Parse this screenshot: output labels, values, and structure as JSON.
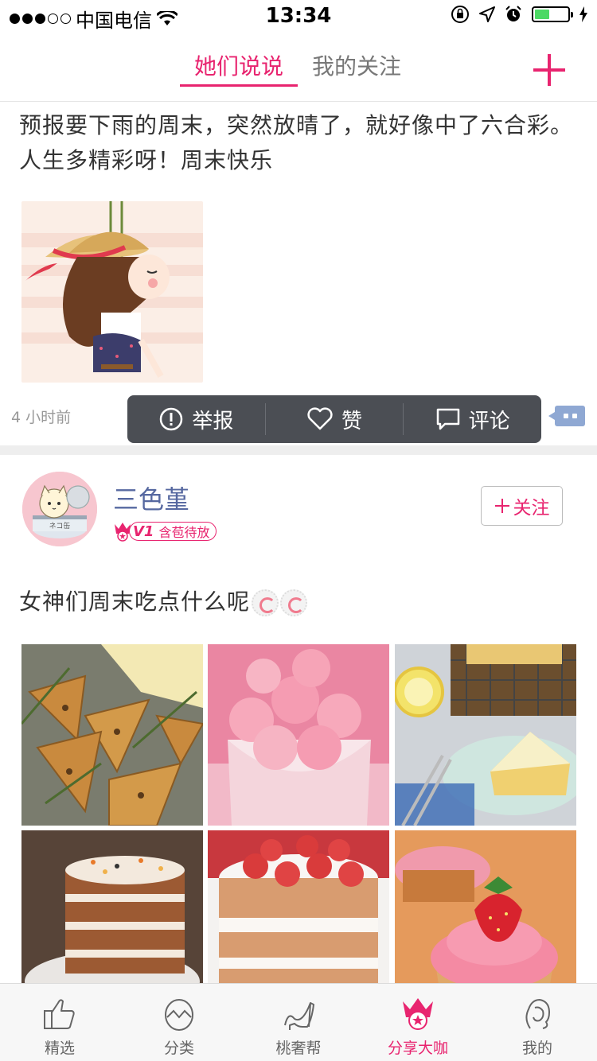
{
  "status_bar": {
    "carrier": "中国电信",
    "time": "13:34",
    "battery_level": 0.45
  },
  "nav": {
    "tabs": [
      {
        "label": "她们说说",
        "active": true
      },
      {
        "label": "我的关注",
        "active": false
      }
    ],
    "add_icon": "plus-icon"
  },
  "post1": {
    "text": "预报要下雨的周末，突然放晴了，就好像中了六合彩。人生多精彩呀！周末快乐",
    "time": "4 小时前",
    "actions": {
      "report": "举报",
      "like": "赞",
      "comment": "评论"
    }
  },
  "post2": {
    "username": "三色堇",
    "level": "V1",
    "level_title": "含苞待放",
    "follow_label": "关注",
    "text": "女神们周末吃点什么呢"
  },
  "tabbar": {
    "items": [
      {
        "label": "精选",
        "icon": "thumbs-up-icon"
      },
      {
        "label": "分类",
        "icon": "egg-icon"
      },
      {
        "label": "桃奢帮",
        "icon": "high-heel-icon"
      },
      {
        "label": "分享大咖",
        "icon": "lotus-icon",
        "active": true
      },
      {
        "label": "我的",
        "icon": "profile-icon"
      }
    ]
  },
  "colors": {
    "accent": "#e8246f",
    "username": "#5668a0",
    "action_bar": "#4b4e54",
    "comment_toggle": "#8fa8d3"
  }
}
